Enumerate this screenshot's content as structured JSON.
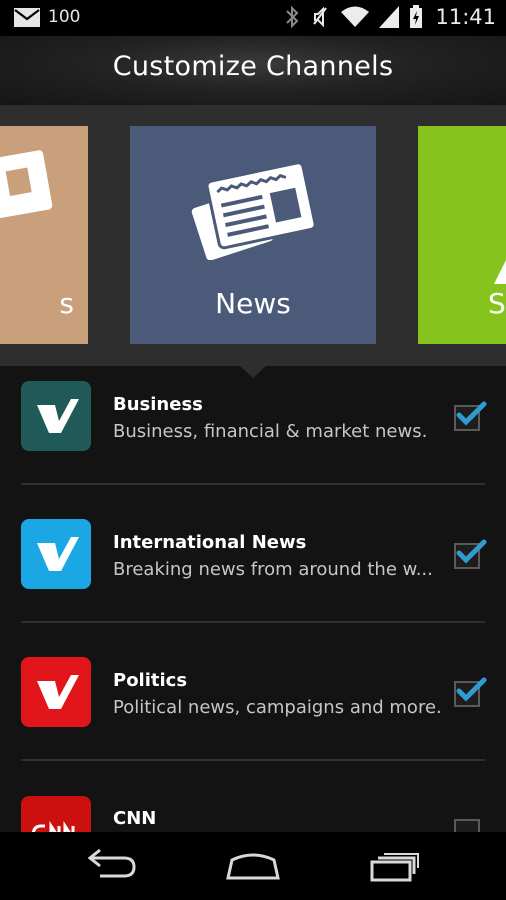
{
  "status_bar": {
    "notification_count": "100",
    "time": "11:41",
    "icons": [
      "mail-icon",
      "bluetooth-icon",
      "mute-icon",
      "wifi-icon",
      "signal-icon",
      "battery-charging-icon"
    ]
  },
  "header": {
    "title": "Customize Channels"
  },
  "carousel": {
    "tiles": [
      {
        "label": "s",
        "color": "#c9a07b",
        "icon": "newspaper-icon"
      },
      {
        "label": "News",
        "color": "#4b5a78",
        "icon": "newspaper-icon",
        "selected": true
      },
      {
        "label": "S",
        "color": "#86c31d",
        "icon": "triangle-icon"
      }
    ]
  },
  "channels": [
    {
      "title": "Business",
      "description": "Business, financial & market news.",
      "icon_color": "#1f5a58",
      "checked": true
    },
    {
      "title": "International News",
      "description": "Breaking news from around the w...",
      "icon_color": "#1aa7e3",
      "checked": true
    },
    {
      "title": "Politics",
      "description": "Political news, campaigns and more.",
      "icon_color": "#e2151b",
      "checked": true
    },
    {
      "title": "CNN",
      "description": "",
      "icon_color": "#cc1010",
      "checked": false
    }
  ],
  "colors": {
    "checkmark": "#2f9bd1",
    "background": "#131313"
  },
  "nav_bar": {
    "buttons": [
      "back-icon",
      "home-icon",
      "recent-apps-icon"
    ]
  }
}
